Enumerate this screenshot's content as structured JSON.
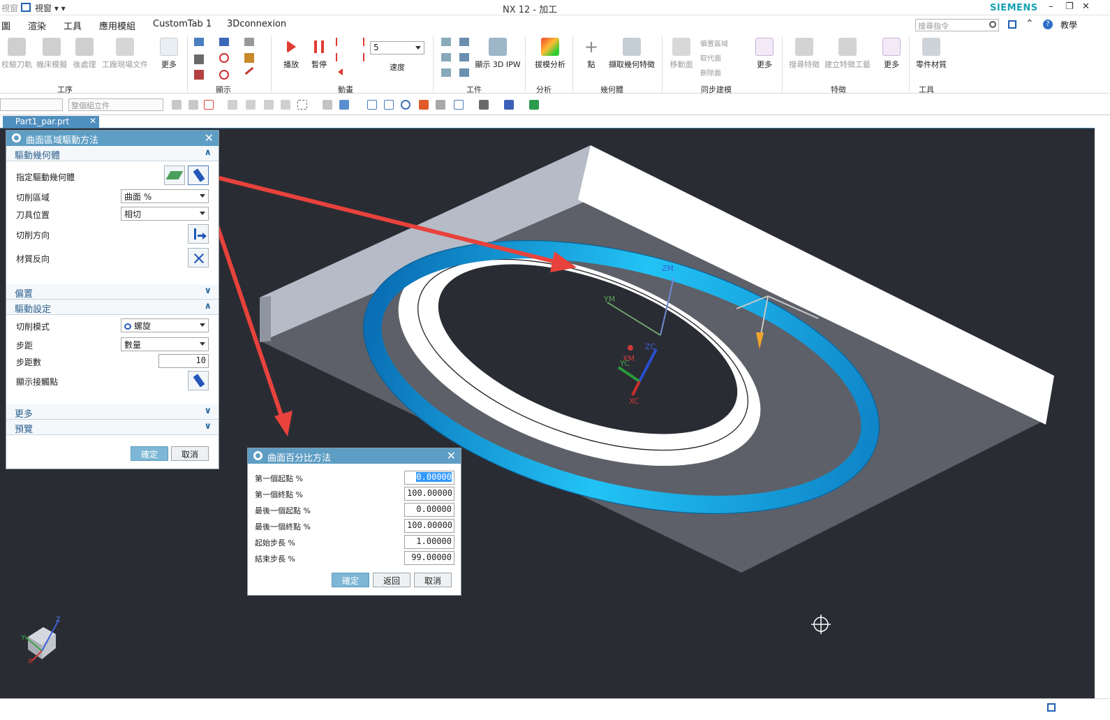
{
  "titlebar": {
    "quick_access": "視窗",
    "window_label": "視窗 ▾ ▾",
    "title": "NX 12 - 加工",
    "brand": "SIEMENS"
  },
  "menu": {
    "items": [
      "圖",
      "渲染",
      "工具",
      "應用模組",
      "CustomTab 1",
      "3Dconnexion"
    ],
    "search_placeholder": "搜尋指令",
    "help_label": "教學"
  },
  "ribbon": {
    "groups": [
      {
        "label": "工序",
        "buttons": [
          "校驗刀軌",
          "機床模擬",
          "後處理",
          "工廠現場文件",
          "更多"
        ]
      },
      {
        "label": "顯示",
        "buttons": []
      },
      {
        "label": "動畫",
        "buttons": [
          "播放",
          "暫停",
          "速度"
        ],
        "speed_value": "5"
      },
      {
        "label": "工件",
        "buttons": [
          "顯示 3D IPW"
        ]
      },
      {
        "label": "分析",
        "buttons": [
          "拔模分析"
        ]
      },
      {
        "label": "幾何體",
        "buttons": [
          "點",
          "擷取幾何特徵"
        ]
      },
      {
        "label": "同步建模",
        "buttons": [
          "移動面",
          "偏置區域",
          "取代面",
          "刪除面",
          "更多"
        ]
      },
      {
        "label": "特徵",
        "buttons": [
          "搜尋特徵",
          "建立特徵工藝",
          "更多"
        ]
      },
      {
        "label": "工具",
        "buttons": [
          "零件材質"
        ]
      }
    ]
  },
  "toolbar": {
    "combo1": "",
    "combo2": "整個組立件"
  },
  "tab": {
    "label": "Part1_par.prt"
  },
  "dialog_drive": {
    "title": "曲面區域驅動方法",
    "sections": {
      "drive_geometry": "驅動幾何體",
      "offset": "偏置",
      "drive_settings": "驅動設定",
      "more": "更多",
      "preview": "預覽"
    },
    "rows": {
      "specify_geometry": "指定驅動幾何體",
      "cut_area": "切削區域",
      "cut_area_value": "曲面 %",
      "tool_position": "刀具位置",
      "tool_position_value": "相切",
      "cut_direction": "切削方向",
      "material_reverse": "材質反向",
      "cut_pattern": "切削模式",
      "cut_pattern_value": "螺旋",
      "stepover": "步距",
      "stepover_value": "數量",
      "stepover_count": "步距數",
      "stepover_count_value": "10",
      "show_contact": "顯示接觸點"
    },
    "ok": "確定",
    "cancel": "取消"
  },
  "dialog_percent": {
    "title": "曲面百分比方法",
    "fields": [
      {
        "label": "第一個起點 %",
        "value": "0.00000"
      },
      {
        "label": "第一個終點 %",
        "value": "100.00000"
      },
      {
        "label": "最後一個起點 %",
        "value": "0.00000"
      },
      {
        "label": "最後一個終點 %",
        "value": "100.00000"
      },
      {
        "label": "起始步長 %",
        "value": "1.00000"
      },
      {
        "label": "結束步長 %",
        "value": "99.00000"
      }
    ],
    "ok": "確定",
    "back": "返回",
    "cancel": "取消"
  },
  "viewport": {
    "axis_labels": {
      "zm": "ZM",
      "ym": "YM",
      "xm": "XM",
      "zc": "ZC",
      "yc": "YC",
      "xc": "XC",
      "z": "Z",
      "y": "Y",
      "x": "X"
    }
  },
  "colors": {
    "ribbon_accent": "#16a2b5",
    "dialog_header": "#5e9ec4",
    "viewport_bg": "#2a2c33",
    "ring": "#19b3ec",
    "arrow": "#e8423c"
  }
}
